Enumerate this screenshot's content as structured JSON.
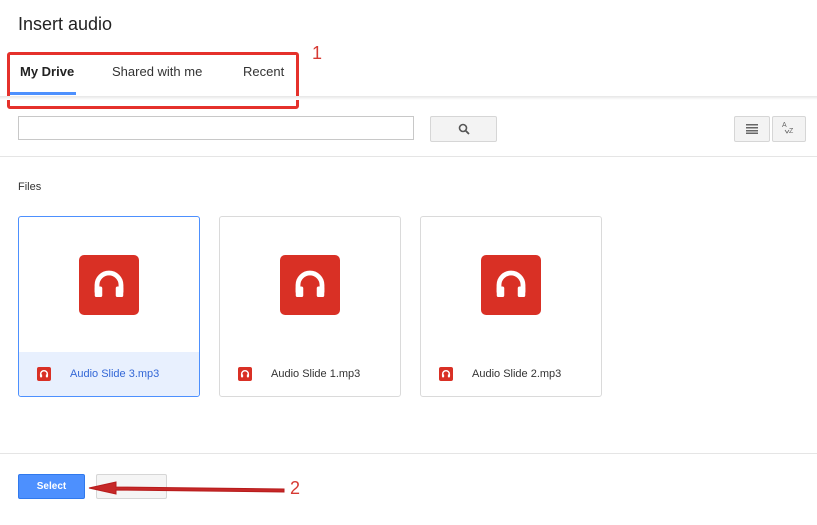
{
  "dialog": {
    "title": "Insert audio"
  },
  "tabs": [
    {
      "label": "My Drive",
      "active": true
    },
    {
      "label": "Shared with me",
      "active": false
    },
    {
      "label": "Recent",
      "active": false
    }
  ],
  "annotations": {
    "tabs_number": "1",
    "select_number": "2"
  },
  "toolbar": {
    "search_value": "",
    "search_icon": "search-icon",
    "list_view_icon": "list-view-icon",
    "sort_icon": "sort-az-icon"
  },
  "section": {
    "label": "Files"
  },
  "files": [
    {
      "name": "Audio Slide 3.mp3",
      "selected": true,
      "icon": "headphones-icon"
    },
    {
      "name": "Audio Slide 1.mp3",
      "selected": false,
      "icon": "headphones-icon"
    },
    {
      "name": "Audio Slide 2.mp3",
      "selected": false,
      "icon": "headphones-icon"
    }
  ],
  "footer": {
    "select_label": "Select",
    "cancel_label": ""
  },
  "colors": {
    "accent": "#4d90fe",
    "audio_red": "#d93025",
    "annotation_red": "#e5312b"
  }
}
